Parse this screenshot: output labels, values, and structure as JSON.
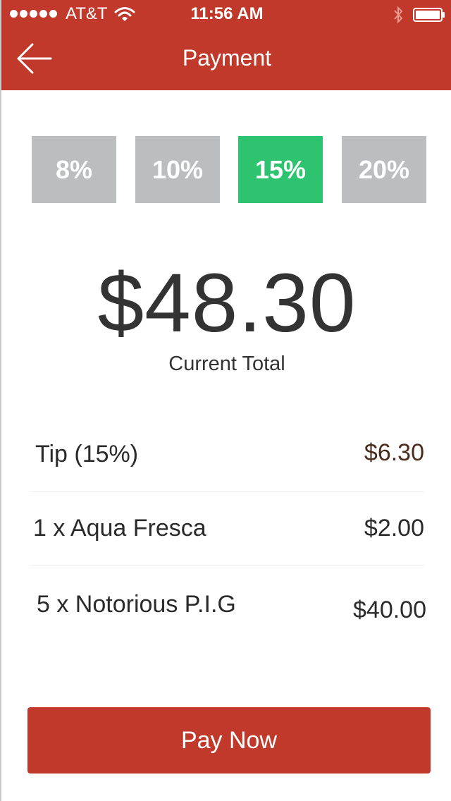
{
  "status_bar": {
    "carrier": "AT&T",
    "time": "11:56 AM"
  },
  "header": {
    "title": "Payment",
    "background": "#c0392b"
  },
  "tip_options": [
    {
      "label": "8%",
      "selected": false
    },
    {
      "label": "10%",
      "selected": false
    },
    {
      "label": "15%",
      "selected": true
    },
    {
      "label": "20%",
      "selected": false
    }
  ],
  "colors": {
    "accent": "#c0392b",
    "selected_tip": "#2ec46f",
    "unselected_tip": "#bbbdbf"
  },
  "total": {
    "amount": "$48.30",
    "label": "Current Total"
  },
  "line_items": [
    {
      "name": "Tip (15%)",
      "price": "$6.30"
    },
    {
      "name": "1 x Aqua Fresca",
      "price": "$2.00"
    },
    {
      "name": "5 x Notorious P.I.G",
      "price": "$40.00"
    }
  ],
  "pay_button": {
    "label": "Pay Now"
  },
  "icons": {
    "back": "arrow-left-icon",
    "wifi": "wifi-icon",
    "bluetooth": "bluetooth-icon",
    "battery": "battery-icon",
    "signal": "signal-dots-icon"
  }
}
